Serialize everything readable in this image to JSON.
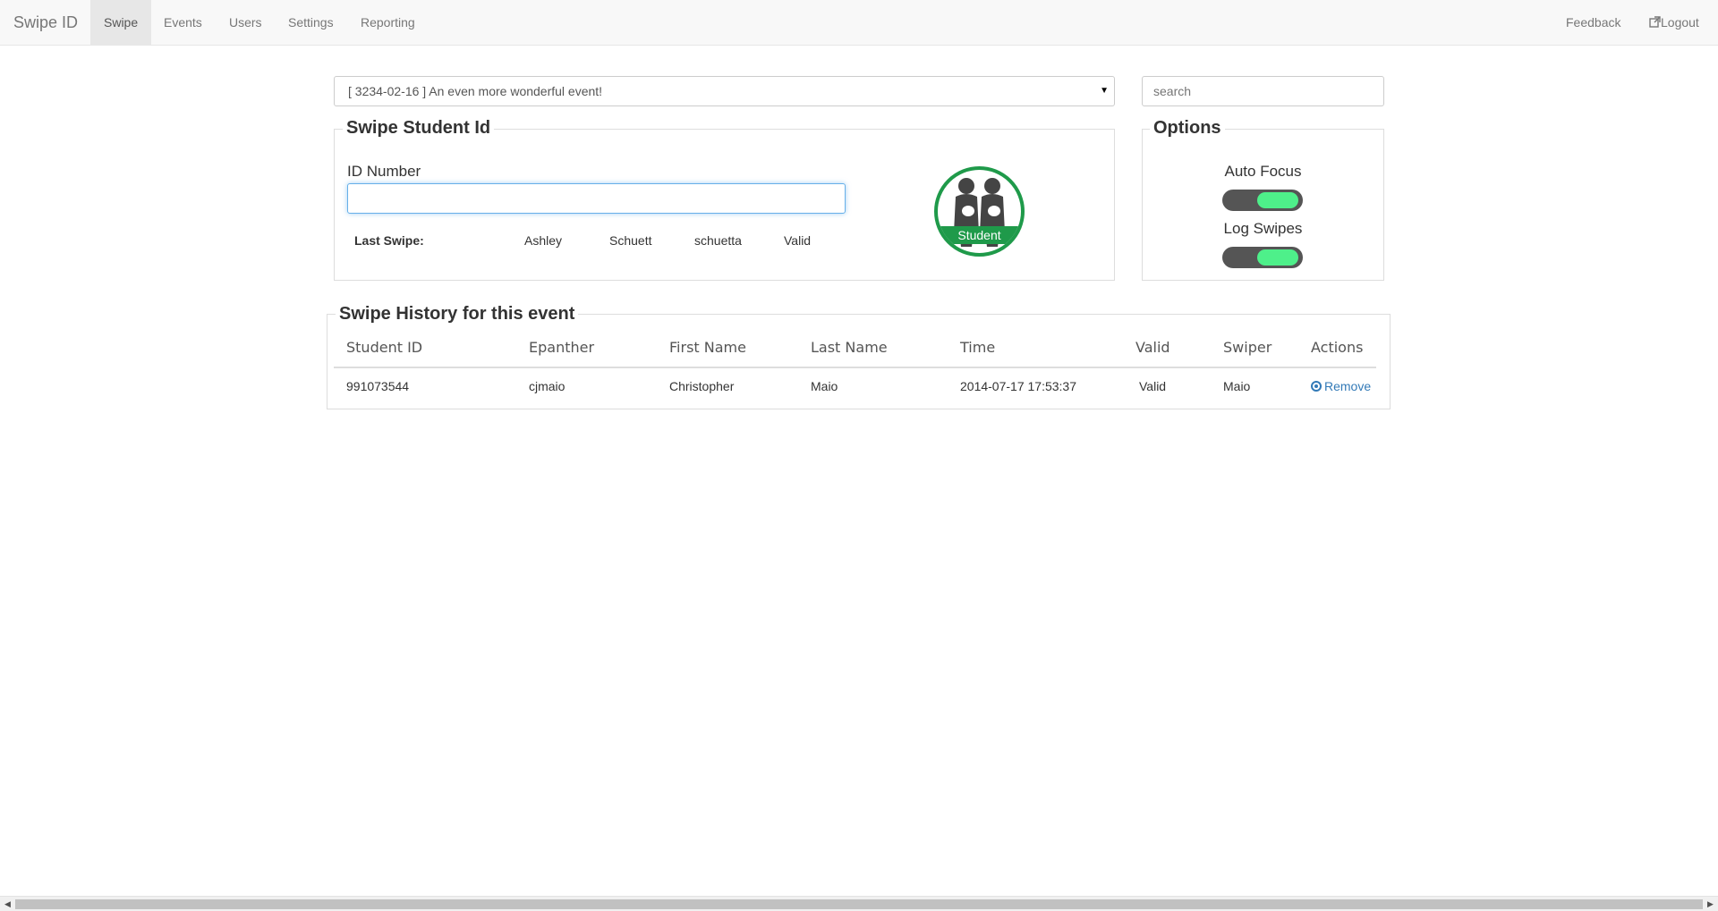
{
  "navbar": {
    "brand": "Swipe ID",
    "items": [
      {
        "label": "Swipe",
        "active": true
      },
      {
        "label": "Events",
        "active": false
      },
      {
        "label": "Users",
        "active": false
      },
      {
        "label": "Settings",
        "active": false
      },
      {
        "label": "Reporting",
        "active": false
      }
    ],
    "right_items": [
      {
        "label": "Feedback"
      },
      {
        "label": "Logout",
        "icon": "external-link-icon"
      }
    ]
  },
  "event_select": {
    "value": "[ 3234-02-16 ] An even more wonderful event!"
  },
  "search": {
    "placeholder": "search"
  },
  "swipe_panel": {
    "legend": "Swipe Student Id",
    "id_label": "ID Number",
    "id_value": "",
    "last_swipe_label": "Last Swipe:",
    "last_swipe": {
      "first_name": "Ashley",
      "last_name": "Schuett",
      "epanther": "schuetta",
      "status": "Valid"
    },
    "badge_label": "Student",
    "badge_color": "#1f9a4a"
  },
  "options_panel": {
    "legend": "Options",
    "auto_focus_label": "Auto Focus",
    "auto_focus_on": true,
    "log_swipes_label": "Log Swipes",
    "log_swipes_on": true,
    "toggle_on_color": "#4ef08a"
  },
  "history": {
    "legend": "Swipe History for this event",
    "columns": [
      "Student ID",
      "Epanther",
      "First Name",
      "Last Name",
      "Time",
      "Valid",
      "Swiper",
      "Actions"
    ],
    "rows": [
      {
        "student_id": "991073544",
        "epanther": "cjmaio",
        "first_name": "Christopher",
        "last_name": "Maio",
        "time": "2014-07-17 17:53:37",
        "valid": "Valid",
        "swiper": "Maio",
        "action": "Remove"
      }
    ]
  }
}
